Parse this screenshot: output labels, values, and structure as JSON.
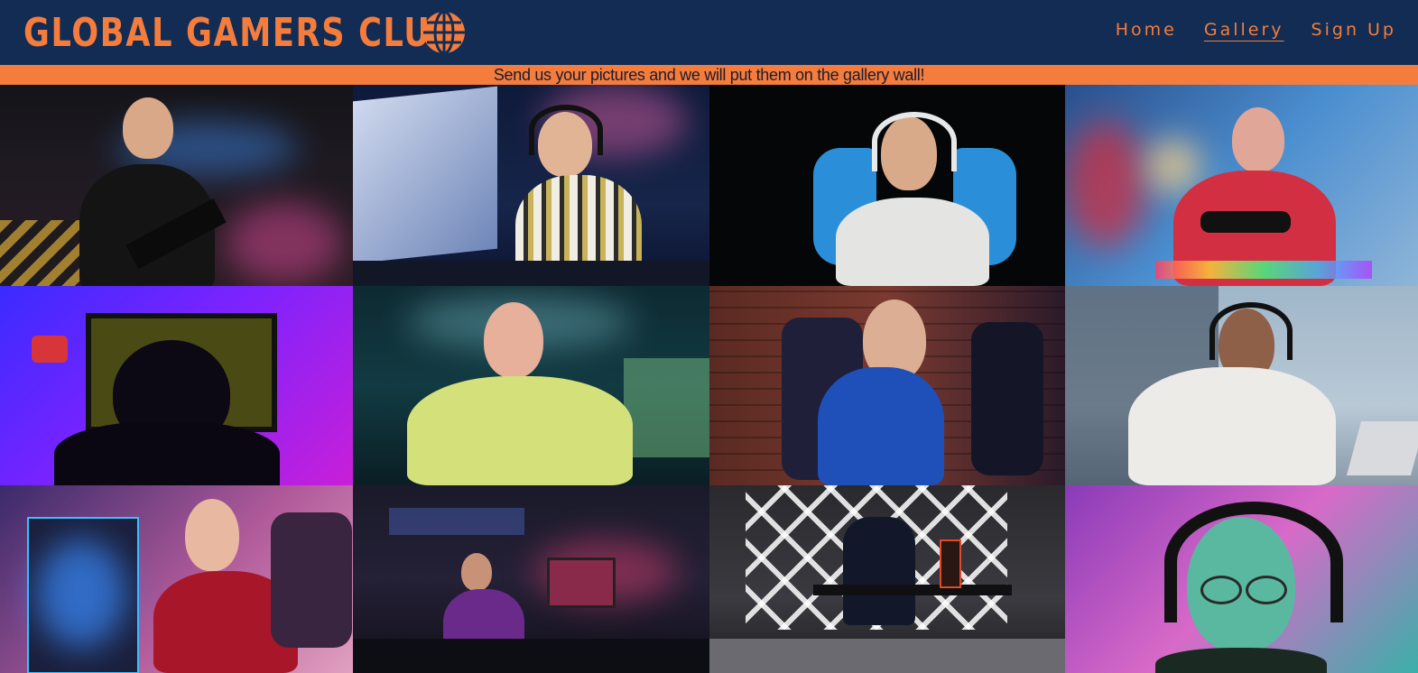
{
  "header": {
    "logo_text": "GLOBAL GAMERS CLUB",
    "logo_icon": "globe-icon"
  },
  "nav": {
    "items": [
      {
        "label": "Home",
        "active": false
      },
      {
        "label": "Gallery",
        "active": true
      },
      {
        "label": "Sign Up",
        "active": false
      }
    ]
  },
  "banner": {
    "text": "Send us your pictures and we will put them on the gallery wall!"
  },
  "colors": {
    "header_bg": "#122c54",
    "accent": "#f47c3c",
    "banner_text": "#1c1c2e"
  },
  "gallery": {
    "count": 12
  }
}
